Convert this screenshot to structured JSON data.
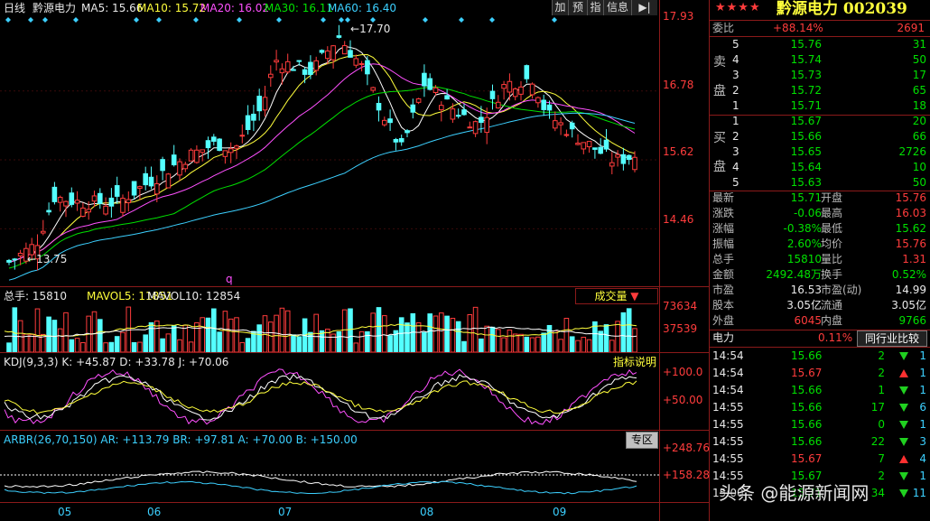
{
  "header": {
    "period": "日线",
    "stock_name": "黔源电力",
    "ma5": "MA5: 15.66",
    "ma10": "MA10: 15.72",
    "ma20": "MA20: 16.02",
    "ma30": "MA30: 16.11",
    "ma60": "MA60: 16.40",
    "buttons": [
      "加",
      "预",
      "指",
      "信息"
    ]
  },
  "price_axis": [
    "17.93",
    "16.78",
    "15.62",
    "14.46"
  ],
  "annotations": {
    "high": "17.70",
    "low": "13.75",
    "q_mark": "q"
  },
  "volume": {
    "label_total": "总手: 15810",
    "label_mavol5": "MAVOL5: 11851",
    "label_mavol10": "MAVOL10: 12854",
    "dropdown": "成交量",
    "axis": [
      "73634",
      "37539"
    ]
  },
  "kdj": {
    "label": "KDJ(9,3,3) K: +45.87  D: +33.78  J: +70.06",
    "help_button": "指标说明",
    "axis": [
      "+100.0",
      "+50.00"
    ]
  },
  "arbr": {
    "label": "ARBR(26,70,150) AR: +113.79  BR: +97.81  A: +70.00  B: +150.00",
    "zone_button": "专区",
    "axis": [
      "+248.76",
      "+158.28"
    ]
  },
  "months": [
    "05",
    "06",
    "07",
    "08",
    "09"
  ],
  "quote": {
    "stars": "★★★★",
    "title": "黔源电力 002039",
    "weibi_label": "委比",
    "weibi_value": "+88.14%",
    "weibi_diff": "2691",
    "sell_side_label": [
      "卖",
      "盘"
    ],
    "sell": [
      {
        "level": "5",
        "price": "15.76",
        "vol": "31"
      },
      {
        "level": "4",
        "price": "15.74",
        "vol": "50"
      },
      {
        "level": "3",
        "price": "15.73",
        "vol": "17"
      },
      {
        "level": "2",
        "price": "15.72",
        "vol": "65"
      },
      {
        "level": "1",
        "price": "15.71",
        "vol": "18"
      }
    ],
    "buy_side_label": [
      "买",
      "盘"
    ],
    "buy": [
      {
        "level": "1",
        "price": "15.67",
        "vol": "20"
      },
      {
        "level": "2",
        "price": "15.66",
        "vol": "66"
      },
      {
        "level": "3",
        "price": "15.65",
        "vol": "2726"
      },
      {
        "level": "4",
        "price": "15.64",
        "vol": "10"
      },
      {
        "level": "5",
        "price": "15.63",
        "vol": "50"
      }
    ],
    "stats": [
      {
        "l1": "最新",
        "v1": "15.71",
        "l2": "开盘",
        "v2": "15.76"
      },
      {
        "l1": "涨跌",
        "v1": "-0.06",
        "l2": "最高",
        "v2": "16.03"
      },
      {
        "l1": "涨幅",
        "v1": "-0.38%",
        "l2": "最低",
        "v2": "15.62"
      },
      {
        "l1": "振幅",
        "v1": "2.60%",
        "l2": "均价",
        "v2": "15.76"
      },
      {
        "l1": "总手",
        "v1": "15810",
        "l2": "量比",
        "v2": "1.31"
      },
      {
        "l1": "金额",
        "v1": "2492.48万",
        "l2": "换手",
        "v2": "0.52%"
      },
      {
        "l1": "市盈",
        "v1": "16.53",
        "l2": "市盈(动)",
        "v2": "14.99"
      },
      {
        "l1": "股本",
        "v1": "3.05亿",
        "l2": "流通",
        "v2": "3.05亿"
      },
      {
        "l1": "外盘",
        "v1": "6045",
        "l2": "内盘",
        "v2": "9766"
      }
    ],
    "sector_label": "电力",
    "sector_change": "0.11%",
    "compare_button": "同行业比较"
  },
  "ticks": [
    {
      "time": "14:54",
      "price": "15.66",
      "vol": "2",
      "dir": "down",
      "count": "1"
    },
    {
      "time": "14:54",
      "price": "15.67",
      "vol": "2",
      "dir": "up",
      "count": "1"
    },
    {
      "time": "14:54",
      "price": "15.66",
      "vol": "1",
      "dir": "down",
      "count": "1"
    },
    {
      "time": "14:55",
      "price": "15.66",
      "vol": "17",
      "dir": "down",
      "count": "6"
    },
    {
      "time": "14:55",
      "price": "15.66",
      "vol": "0",
      "dir": "down",
      "count": "1"
    },
    {
      "time": "14:55",
      "price": "15.66",
      "vol": "22",
      "dir": "down",
      "count": "3"
    },
    {
      "time": "14:55",
      "price": "15.67",
      "vol": "7",
      "dir": "up",
      "count": "4"
    },
    {
      "time": "14:55",
      "price": "15.67",
      "vol": "2",
      "dir": "down",
      "count": "1"
    },
    {
      "time": "15:00",
      "price": "15.71",
      "vol": "34",
      "dir": "down",
      "count": "11"
    }
  ],
  "watermark": "头条 @能源新闻网",
  "colors": {
    "up": "#ff3c3c",
    "down": "#00e000",
    "ma5": "#ffffff",
    "ma10": "#ffff3c",
    "ma20": "#ff50ff",
    "ma30": "#00e000",
    "ma60": "#3cd0ff",
    "candle_down": "#54ffff"
  }
}
